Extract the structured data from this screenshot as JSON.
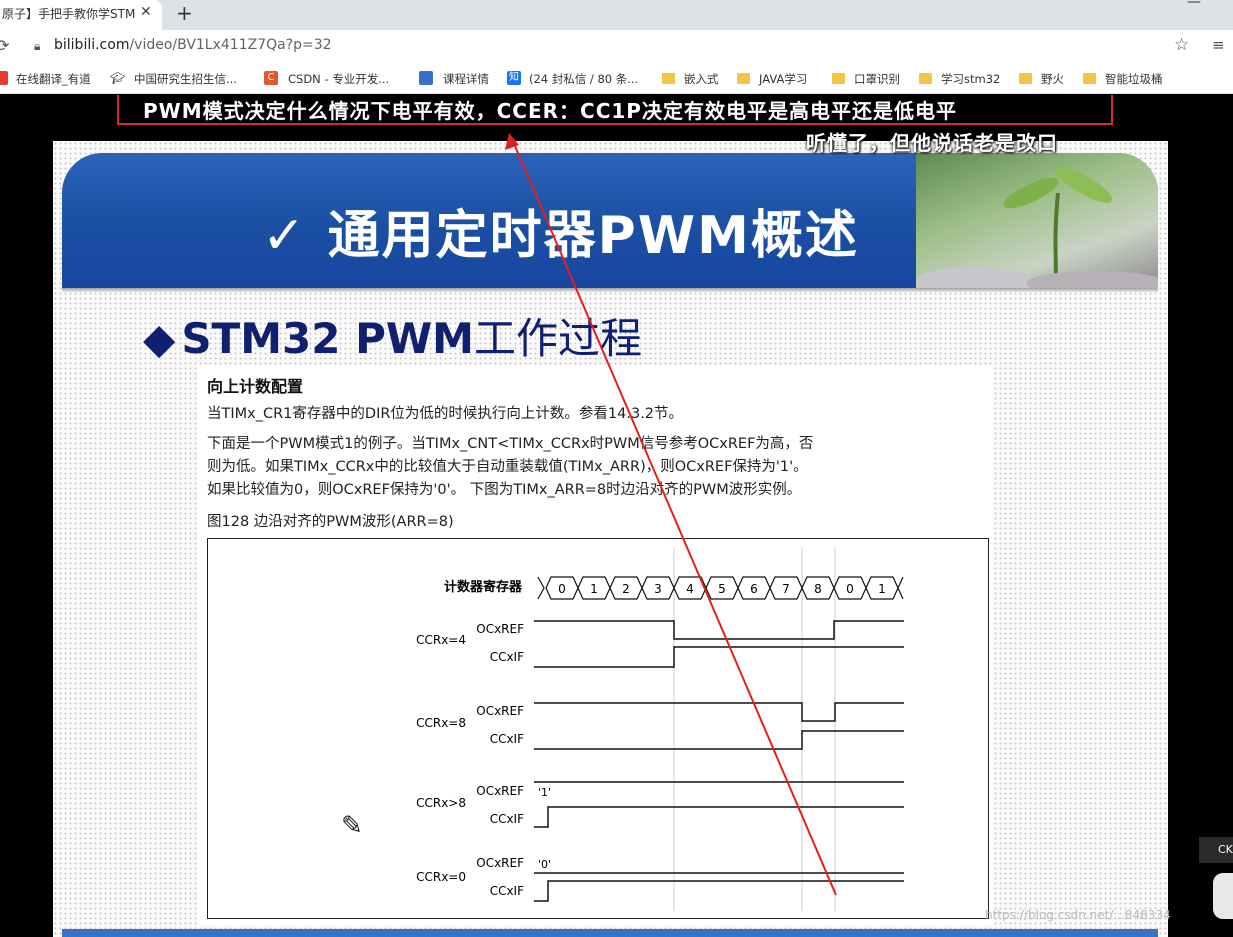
{
  "browser": {
    "tab_title": "原子】手把手教你学STM",
    "tab_close": "✕",
    "new_tab": "+",
    "window_min": "—",
    "url_host": "bilibili.com",
    "url_path": "/video/BV1Lx411Z7Qa?p=32",
    "bookmarks": [
      "在线翻译_有道",
      "中国研究生招生信...",
      "CSDN - 专业开发...",
      "课程详情",
      "(24 封私信 / 80 条...",
      "嵌入式",
      "JAVA学习",
      "口罩识别",
      "学习stm32",
      "野火",
      "智能垃圾桶"
    ],
    "csdn_icon": "C",
    "zhihu_icon": "知"
  },
  "video": {
    "subtitle_line1": "PWM模式决定什么情况下电平有效，CCER：CC1P决定有效电平是高电平还是低电平",
    "subtitle_line2": "听懂了，但他说话老是改口",
    "watermark": "https://blog.csdn.net/...848334",
    "side_button": "CK"
  },
  "slide": {
    "banner_title": "✓ 通用定时器PWM概述",
    "section_diamond": "◆",
    "section_title_bold": "STM32 PWM",
    "section_title_rest": "工作过程",
    "doc_heading": "向上计数配置",
    "doc_p1": "当TIMx_CR1寄存器中的DIR位为低的时候执行向上计数。参看14.3.2节。",
    "doc_p2": "下面是一个PWM模式1的例子。当TIMx_CNT<TIMx_CCRx时PWM信号参考OCxREF为高，否",
    "doc_p3": "则为低。如果TIMx_CCRx中的比较值大于自动重装载值(TIMx_ARR)，则OCxREF保持为'1'。",
    "doc_p4": "如果比较值为0，则OCxREF保持为'0'。 下图为TIMx_ARR=8时边沿对齐的PWM波形实例。",
    "fig_caption": "图128    边沿对齐的PWM波形(ARR=8)"
  },
  "waveform": {
    "counter_label": "计数器寄存器",
    "counter_values": [
      "0",
      "1",
      "2",
      "3",
      "4",
      "5",
      "6",
      "7",
      "8",
      "0",
      "1"
    ],
    "groups": [
      {
        "ccr": "CCRx=4",
        "ref": "OCxREF",
        "if": "CCxIF",
        "note": ""
      },
      {
        "ccr": "CCRx=8",
        "ref": "OCxREF",
        "if": "CCxIF",
        "note": ""
      },
      {
        "ccr": "CCRx>8",
        "ref": "OCxREF",
        "if": "CCxIF",
        "note": "'1'"
      },
      {
        "ccr": "CCRx=0",
        "ref": "OCxREF",
        "if": "CCxIF",
        "note": "'0'"
      }
    ]
  }
}
